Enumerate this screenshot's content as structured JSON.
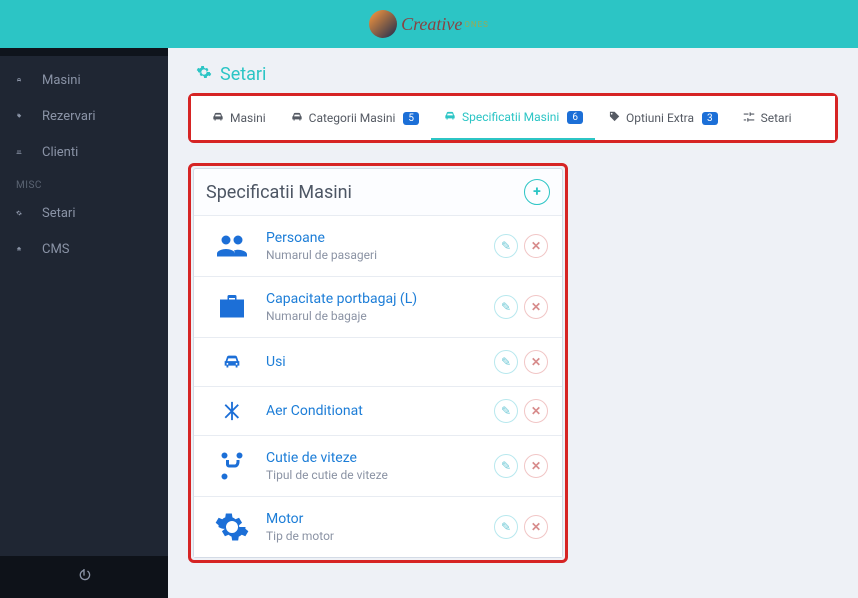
{
  "brand": {
    "text": "Creative",
    "sub": "ONES"
  },
  "sidebar": {
    "items": [
      {
        "label": "Masini"
      },
      {
        "label": "Rezervari"
      },
      {
        "label": "Clienti"
      }
    ],
    "misc_label": "MISC",
    "misc_items": [
      {
        "label": "Setari"
      },
      {
        "label": "CMS"
      }
    ]
  },
  "page": {
    "title": "Setari"
  },
  "tabs": [
    {
      "label": "Masini"
    },
    {
      "label": "Categorii Masini",
      "badge": "5"
    },
    {
      "label": "Specificatii Masini",
      "badge": "6",
      "active": true
    },
    {
      "label": "Optiuni Extra",
      "badge": "3"
    },
    {
      "label": "Setari"
    }
  ],
  "panel": {
    "title": "Specificatii Masini",
    "specs": [
      {
        "title": "Persoane",
        "sub": "Numarul de pasageri",
        "icon": "users"
      },
      {
        "title": "Capacitate portbagaj (L)",
        "sub": "Numarul de bagaje",
        "icon": "briefcase"
      },
      {
        "title": "Usi",
        "sub": "",
        "icon": "car"
      },
      {
        "title": "Aer Conditionat",
        "sub": "",
        "icon": "snow"
      },
      {
        "title": "Cutie de viteze",
        "sub": "Tipul de cutie de viteze",
        "icon": "branch"
      },
      {
        "title": "Motor",
        "sub": "Tip de motor",
        "icon": "gear"
      }
    ]
  }
}
